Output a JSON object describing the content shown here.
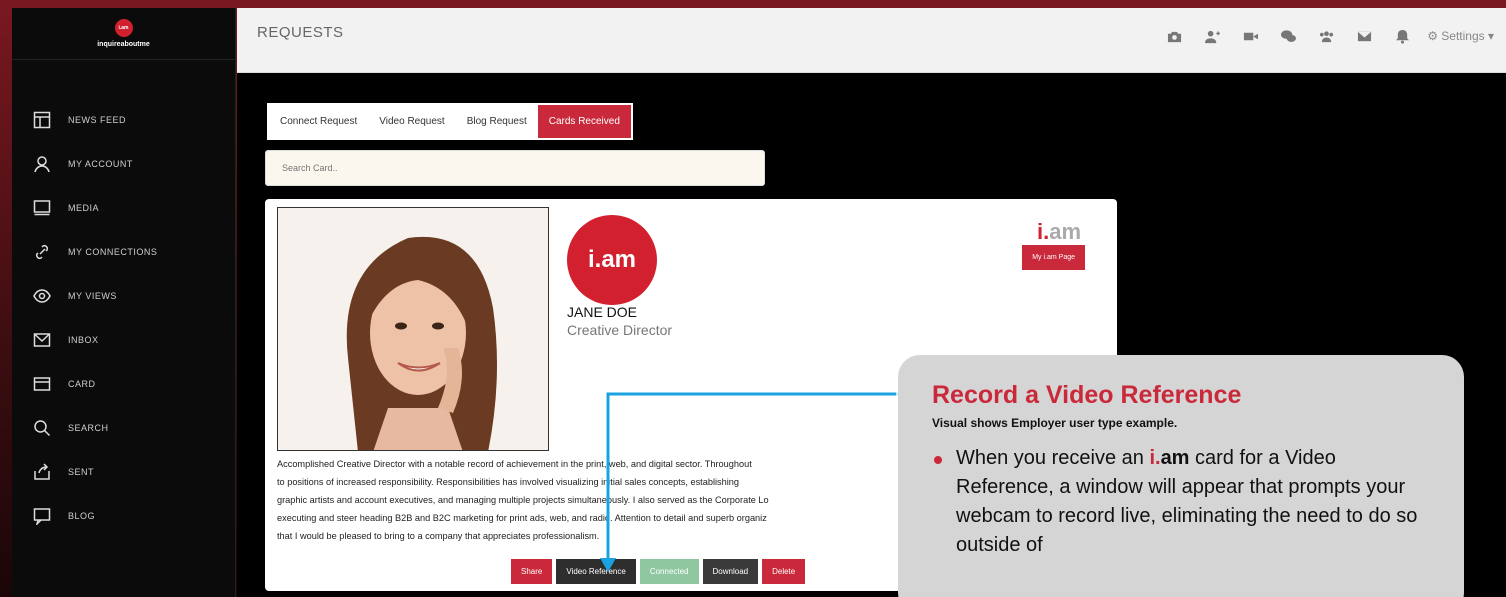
{
  "brand": {
    "logo_text": "i.am",
    "name": "inquireaboutme"
  },
  "sidebar": {
    "items": [
      {
        "label": "NEWS FEED",
        "icon": "news-feed-icon"
      },
      {
        "label": "MY ACCOUNT",
        "icon": "user-icon"
      },
      {
        "label": "MEDIA",
        "icon": "monitor-icon"
      },
      {
        "label": "MY CONNECTIONS",
        "icon": "link-icon"
      },
      {
        "label": "MY VIEWS",
        "icon": "eye-icon"
      },
      {
        "label": "INBOX",
        "icon": "envelope-icon"
      },
      {
        "label": "CARD",
        "icon": "card-icon"
      },
      {
        "label": "SEARCH",
        "icon": "search-icon"
      },
      {
        "label": "SENT",
        "icon": "share-icon"
      },
      {
        "label": "BLOG",
        "icon": "chat-icon"
      }
    ]
  },
  "header": {
    "title": "REQUESTS",
    "icons": [
      "camera-icon",
      "add-user-icon",
      "video-icon",
      "chat-icon",
      "group-icon",
      "mail-icon",
      "bell-icon"
    ],
    "settings_label": "Settings"
  },
  "tabs": [
    {
      "label": "Connect Request",
      "active": false
    },
    {
      "label": "Video Request",
      "active": false
    },
    {
      "label": "Blog Request",
      "active": false
    },
    {
      "label": "Cards Received",
      "active": true
    }
  ],
  "search": {
    "placeholder": "Search Card.."
  },
  "card": {
    "logo_text": "i.am",
    "name": "JANE DOE",
    "title": "Creative Director",
    "iam_mark_dot": "i.",
    "iam_mark_rest": "am",
    "my_page_button": "My i.am Page",
    "bio_lines": [
      "Accomplished Creative Director with a notable record of achievement in the print, web, and digital sector. Throughout",
      "to positions of increased responsibility. Responsibilities has involved visualizing initial sales concepts, establishing",
      "graphic artists and account executives, and managing multiple projects simultaneously. I also served as the Corporate Lo",
      "executing and steer heading B2B and B2C marketing for print ads, web, and radio. Attention to detail and superb organiz",
      "that I would be pleased to bring to a company that appreciates professionalism."
    ],
    "actions": {
      "share": "Share",
      "video_reference": "Video Reference",
      "connected": "Connected",
      "download": "Download",
      "delete": "Delete"
    }
  },
  "callout": {
    "title": "Record a Video Reference",
    "subtitle": "Visual shows Employer user type example.",
    "bullet_pre": "When you receive an ",
    "bullet_iam_dot": "i.",
    "bullet_iam_rest": "am",
    "bullet_post": " card for a Video Reference, a window will appear that prompts your webcam to record live, eliminating the need to do so outside of"
  },
  "colors": {
    "accent": "#c9293a",
    "connected": "#8fc7a0",
    "dark_button": "#2e2e2e",
    "callout_bg": "#d5d5d5",
    "arrow": "#1aa3e0"
  }
}
